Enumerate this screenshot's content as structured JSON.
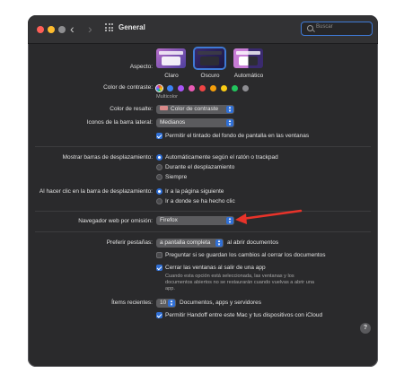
{
  "window": {
    "title": "General",
    "back_icon": "‹",
    "forward_icon": "›",
    "search_placeholder": "Buscar"
  },
  "appearance": {
    "label": "Aspecto:",
    "options": [
      "Claro",
      "Oscuro",
      "Automático"
    ],
    "selected": "Oscuro"
  },
  "accent": {
    "label": "Color de contraste:",
    "colors": [
      "#3b82f6",
      "#a855f7",
      "#e95bb5",
      "#ef4444",
      "#f59e0b",
      "#facc15",
      "#22c55e",
      "#8e8e93"
    ],
    "selected_name": "Multicolor"
  },
  "highlight": {
    "label": "Color de resalte:",
    "value": "Color de contraste",
    "swatch_color": "#d98a8a"
  },
  "sidebar_icons": {
    "label": "Iconos de la barra lateral:",
    "value": "Medianos"
  },
  "wallpaper_tint": {
    "label": "Permitir el tintado del fondo de pantalla en las ventanas",
    "checked": true
  },
  "scrollbars": {
    "label": "Mostrar barras de desplazamiento:",
    "options": [
      "Automáticamente según el ratón o trackpad",
      "Durante el desplazamiento",
      "Siempre"
    ],
    "selected_index": 0
  },
  "scroll_click": {
    "label": "Al hacer clic en la barra de desplazamiento:",
    "options": [
      "Ir a la página siguiente",
      "Ir a donde se ha hecho clic"
    ],
    "selected_index": 0
  },
  "browser": {
    "label": "Navegador web por omisión:",
    "value": "Firefox"
  },
  "tabs_pref": {
    "label": "Preferir pestañas:",
    "value": "a pantalla completa",
    "suffix": "al abrir documentos"
  },
  "ask_save": {
    "label": "Preguntar si se guardan los cambios al cerrar los documentos",
    "checked": false
  },
  "close_windows": {
    "label": "Cerrar las ventanas al salir de una app",
    "checked": true,
    "description": [
      "Cuando esta opción está seleccionada, las ventanas y los",
      "documentos abiertos no se restaurarán cuando vuelvas a abrir una",
      "app."
    ]
  },
  "recent_items": {
    "label": "Ítems recientes:",
    "value": "10",
    "suffix": "Documentos, apps y servidores"
  },
  "handoff": {
    "label": "Permitir Handoff entre este Mac y tus dispositivos con iCloud",
    "checked": true
  },
  "help_label": "?",
  "annotation_color": "#e8332a"
}
